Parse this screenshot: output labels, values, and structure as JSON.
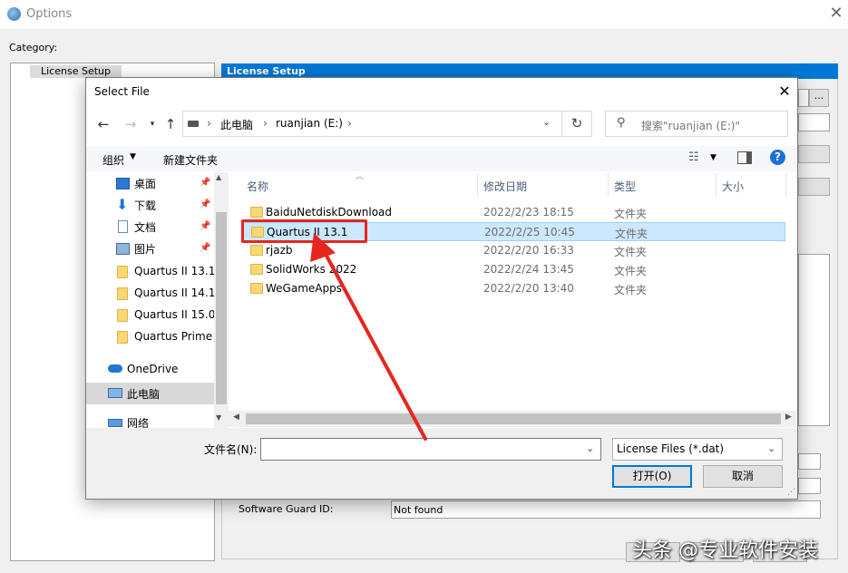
{
  "options_window": {
    "title": "Options",
    "category_label": "Category:",
    "category_item": "License Setup",
    "panel_header": "License Setup",
    "software_guard_label": "Software Guard ID:",
    "software_guard_value": "Not found",
    "browse_label": "..."
  },
  "dialog": {
    "title": "Select File",
    "address": {
      "root": "此电脑",
      "folder": "ruanjian (E:)"
    },
    "search_placeholder": "搜索\"ruanjian (E:)\"",
    "toolbar": {
      "organize": "组织",
      "new_folder": "新建文件夹"
    },
    "nav_items": [
      {
        "label": "桌面",
        "icon": "desktop-icon",
        "pinned": true
      },
      {
        "label": "下载",
        "icon": "download-icon",
        "pinned": true
      },
      {
        "label": "文档",
        "icon": "document-icon",
        "pinned": true
      },
      {
        "label": "图片",
        "icon": "picture-icon",
        "pinned": true
      },
      {
        "label": "Quartus II 13.1",
        "icon": "folder-icon"
      },
      {
        "label": "Quartus II 14.1",
        "icon": "folder-icon"
      },
      {
        "label": "Quartus II 15.0",
        "icon": "folder-icon"
      },
      {
        "label": "Quartus Prime",
        "icon": "folder-icon"
      },
      {
        "label": "OneDrive",
        "icon": "cloud-icon"
      },
      {
        "label": "此电脑",
        "icon": "computer-icon",
        "selected": true
      },
      {
        "label": "网络",
        "icon": "network-icon"
      }
    ],
    "columns": {
      "name": "名称",
      "date": "修改日期",
      "type": "类型",
      "size": "大小"
    },
    "files": [
      {
        "name": "BaiduNetdiskDownload",
        "date": "2022/2/23 18:15",
        "type": "文件夹"
      },
      {
        "name": "Quartus II 13.1",
        "date": "2022/2/25 10:45",
        "type": "文件夹",
        "selected": true
      },
      {
        "name": "rjazb",
        "date": "2022/2/20 16:33",
        "type": "文件夹"
      },
      {
        "name": "SolidWorks 2022",
        "date": "2022/2/24 13:45",
        "type": "文件夹"
      },
      {
        "name": "WeGameApps",
        "date": "2022/2/20 13:40",
        "type": "文件夹"
      }
    ],
    "filename_label": "文件名(N):",
    "filename_value": "",
    "filetype": "License Files (*.dat)",
    "open_label": "打开(O)",
    "cancel_label": "取消"
  },
  "watermark": "头条 @专业软件安装",
  "colors": {
    "accent": "#0078d7",
    "highlight": "#e8251f",
    "selection": "#cce8ff"
  }
}
